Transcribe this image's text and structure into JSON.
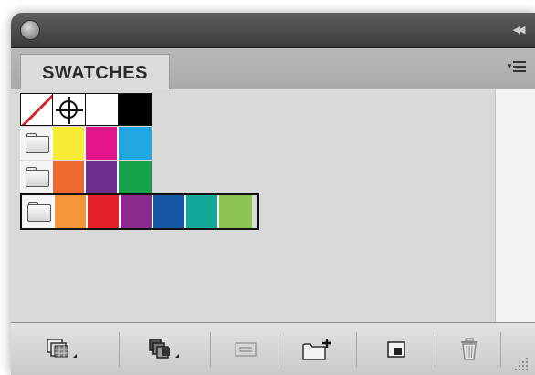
{
  "panel": {
    "tab_label": "SWATCHES",
    "collapse_icon": "double-chevron-right-icon",
    "menu_icon": "panel-menu-icon"
  },
  "swatches": {
    "row1": [
      {
        "name": "none",
        "color": "#ffffff"
      },
      {
        "name": "registration",
        "color": "#ffffff"
      },
      {
        "name": "white",
        "color": "#ffffff"
      },
      {
        "name": "black",
        "color": "#000000"
      }
    ],
    "groups": [
      {
        "colors": [
          "#f8eb35",
          "#e6148b",
          "#21a8e1"
        ]
      },
      {
        "colors": [
          "#ef6a2f",
          "#6c2e8f",
          "#17a34a"
        ]
      },
      {
        "colors": [
          "#f4963a",
          "#e52229",
          "#8d2a8e",
          "#1556a3",
          "#13a89a",
          "#8dc353"
        ]
      }
    ]
  },
  "footer": {
    "buttons": [
      {
        "icon": "swatch-libraries-icon"
      },
      {
        "icon": "show-swatch-kinds-icon"
      },
      {
        "icon": "swatch-options-icon"
      },
      {
        "icon": "new-color-group-icon"
      },
      {
        "icon": "new-swatch-icon"
      },
      {
        "icon": "delete-swatch-icon"
      }
    ]
  }
}
